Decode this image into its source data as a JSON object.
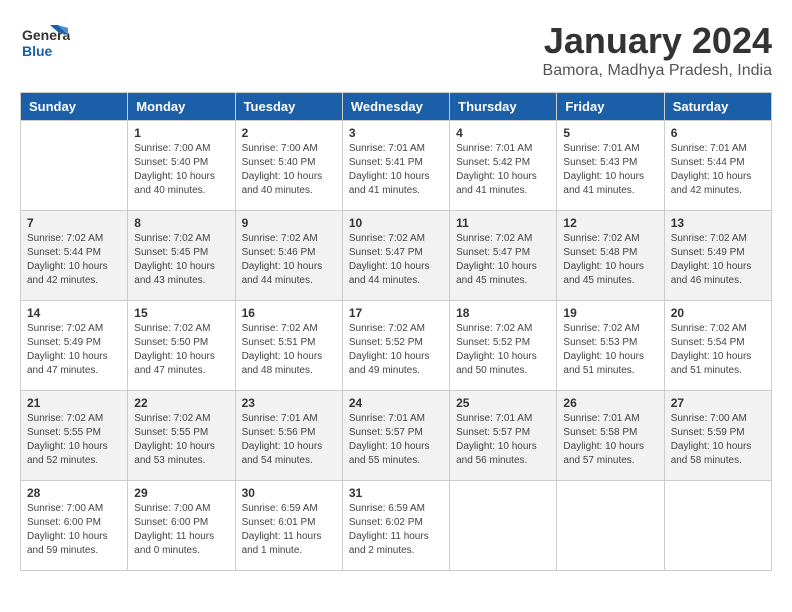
{
  "header": {
    "logo_general": "General",
    "logo_blue": "Blue",
    "title": "January 2024",
    "subtitle": "Bamora, Madhya Pradesh, India"
  },
  "days_of_week": [
    "Sunday",
    "Monday",
    "Tuesday",
    "Wednesday",
    "Thursday",
    "Friday",
    "Saturday"
  ],
  "weeks": [
    [
      {
        "day": "",
        "info": ""
      },
      {
        "day": "1",
        "info": "Sunrise: 7:00 AM\nSunset: 5:40 PM\nDaylight: 10 hours\nand 40 minutes."
      },
      {
        "day": "2",
        "info": "Sunrise: 7:00 AM\nSunset: 5:40 PM\nDaylight: 10 hours\nand 40 minutes."
      },
      {
        "day": "3",
        "info": "Sunrise: 7:01 AM\nSunset: 5:41 PM\nDaylight: 10 hours\nand 41 minutes."
      },
      {
        "day": "4",
        "info": "Sunrise: 7:01 AM\nSunset: 5:42 PM\nDaylight: 10 hours\nand 41 minutes."
      },
      {
        "day": "5",
        "info": "Sunrise: 7:01 AM\nSunset: 5:43 PM\nDaylight: 10 hours\nand 41 minutes."
      },
      {
        "day": "6",
        "info": "Sunrise: 7:01 AM\nSunset: 5:44 PM\nDaylight: 10 hours\nand 42 minutes."
      }
    ],
    [
      {
        "day": "7",
        "info": "Sunrise: 7:02 AM\nSunset: 5:44 PM\nDaylight: 10 hours\nand 42 minutes."
      },
      {
        "day": "8",
        "info": "Sunrise: 7:02 AM\nSunset: 5:45 PM\nDaylight: 10 hours\nand 43 minutes."
      },
      {
        "day": "9",
        "info": "Sunrise: 7:02 AM\nSunset: 5:46 PM\nDaylight: 10 hours\nand 44 minutes."
      },
      {
        "day": "10",
        "info": "Sunrise: 7:02 AM\nSunset: 5:47 PM\nDaylight: 10 hours\nand 44 minutes."
      },
      {
        "day": "11",
        "info": "Sunrise: 7:02 AM\nSunset: 5:47 PM\nDaylight: 10 hours\nand 45 minutes."
      },
      {
        "day": "12",
        "info": "Sunrise: 7:02 AM\nSunset: 5:48 PM\nDaylight: 10 hours\nand 45 minutes."
      },
      {
        "day": "13",
        "info": "Sunrise: 7:02 AM\nSunset: 5:49 PM\nDaylight: 10 hours\nand 46 minutes."
      }
    ],
    [
      {
        "day": "14",
        "info": "Sunrise: 7:02 AM\nSunset: 5:49 PM\nDaylight: 10 hours\nand 47 minutes."
      },
      {
        "day": "15",
        "info": "Sunrise: 7:02 AM\nSunset: 5:50 PM\nDaylight: 10 hours\nand 47 minutes."
      },
      {
        "day": "16",
        "info": "Sunrise: 7:02 AM\nSunset: 5:51 PM\nDaylight: 10 hours\nand 48 minutes."
      },
      {
        "day": "17",
        "info": "Sunrise: 7:02 AM\nSunset: 5:52 PM\nDaylight: 10 hours\nand 49 minutes."
      },
      {
        "day": "18",
        "info": "Sunrise: 7:02 AM\nSunset: 5:52 PM\nDaylight: 10 hours\nand 50 minutes."
      },
      {
        "day": "19",
        "info": "Sunrise: 7:02 AM\nSunset: 5:53 PM\nDaylight: 10 hours\nand 51 minutes."
      },
      {
        "day": "20",
        "info": "Sunrise: 7:02 AM\nSunset: 5:54 PM\nDaylight: 10 hours\nand 51 minutes."
      }
    ],
    [
      {
        "day": "21",
        "info": "Sunrise: 7:02 AM\nSunset: 5:55 PM\nDaylight: 10 hours\nand 52 minutes."
      },
      {
        "day": "22",
        "info": "Sunrise: 7:02 AM\nSunset: 5:55 PM\nDaylight: 10 hours\nand 53 minutes."
      },
      {
        "day": "23",
        "info": "Sunrise: 7:01 AM\nSunset: 5:56 PM\nDaylight: 10 hours\nand 54 minutes."
      },
      {
        "day": "24",
        "info": "Sunrise: 7:01 AM\nSunset: 5:57 PM\nDaylight: 10 hours\nand 55 minutes."
      },
      {
        "day": "25",
        "info": "Sunrise: 7:01 AM\nSunset: 5:57 PM\nDaylight: 10 hours\nand 56 minutes."
      },
      {
        "day": "26",
        "info": "Sunrise: 7:01 AM\nSunset: 5:58 PM\nDaylight: 10 hours\nand 57 minutes."
      },
      {
        "day": "27",
        "info": "Sunrise: 7:00 AM\nSunset: 5:59 PM\nDaylight: 10 hours\nand 58 minutes."
      }
    ],
    [
      {
        "day": "28",
        "info": "Sunrise: 7:00 AM\nSunset: 6:00 PM\nDaylight: 10 hours\nand 59 minutes."
      },
      {
        "day": "29",
        "info": "Sunrise: 7:00 AM\nSunset: 6:00 PM\nDaylight: 11 hours\nand 0 minutes."
      },
      {
        "day": "30",
        "info": "Sunrise: 6:59 AM\nSunset: 6:01 PM\nDaylight: 11 hours\nand 1 minute."
      },
      {
        "day": "31",
        "info": "Sunrise: 6:59 AM\nSunset: 6:02 PM\nDaylight: 11 hours\nand 2 minutes."
      },
      {
        "day": "",
        "info": ""
      },
      {
        "day": "",
        "info": ""
      },
      {
        "day": "",
        "info": ""
      }
    ]
  ]
}
